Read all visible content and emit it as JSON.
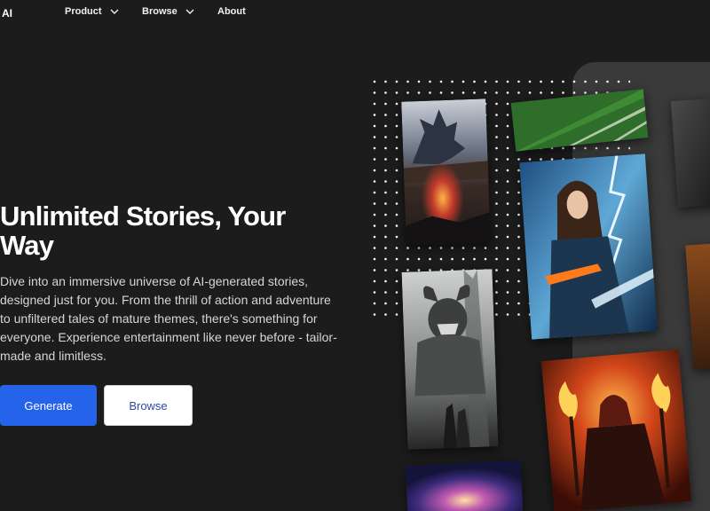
{
  "brand": {
    "logo_text": "AI"
  },
  "nav": {
    "items": [
      {
        "label": "Product",
        "has_dropdown": true
      },
      {
        "label": "Browse",
        "has_dropdown": true
      },
      {
        "label": "About",
        "has_dropdown": false
      }
    ]
  },
  "hero": {
    "title": "Unlimited Stories, Your Way",
    "description": "Dive into an immersive universe of AI-generated stories, designed just for you. From the thrill of action and adventure to unfiltered tales of mature themes, there's something for everyone. Experience entertainment like never before - tailor-made and limitless.",
    "primary_button": "Generate",
    "secondary_button": "Browse"
  },
  "gallery": {
    "images": [
      {
        "name": "dragon-cliff-image",
        "icon": "dragon"
      },
      {
        "name": "green-field-image",
        "icon": "field"
      },
      {
        "name": "dark-scene-image",
        "icon": "shadow"
      },
      {
        "name": "sorceress-lightning-image",
        "icon": "mage"
      },
      {
        "name": "horned-beast-image",
        "icon": "beast"
      },
      {
        "name": "fire-warrior-image",
        "icon": "fire"
      },
      {
        "name": "orange-scene-image",
        "icon": "flame"
      },
      {
        "name": "nebula-image",
        "icon": "galaxy"
      }
    ]
  },
  "colors": {
    "background": "#1c1c1c",
    "primary": "#2563eb",
    "secondary_bg": "#ffffff",
    "secondary_text": "#2b4aa8",
    "panel": "#3a3a3a"
  }
}
